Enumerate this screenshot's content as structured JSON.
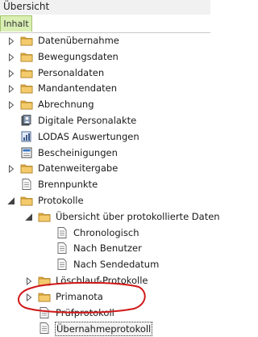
{
  "header": {
    "title": "Übersicht"
  },
  "tabs": [
    {
      "label": "Inhalt",
      "active": true
    }
  ],
  "tree": [
    {
      "label": "Datenübernahme",
      "icon": "folder-icon",
      "expander": "collapsed",
      "level": 0
    },
    {
      "label": "Bewegungsdaten",
      "icon": "folder-icon",
      "expander": "collapsed",
      "level": 0
    },
    {
      "label": "Personaldaten",
      "icon": "folder-icon",
      "expander": "collapsed",
      "level": 0
    },
    {
      "label": "Mandantendaten",
      "icon": "folder-icon",
      "expander": "collapsed",
      "level": 0
    },
    {
      "label": "Abrechnung",
      "icon": "folder-icon",
      "expander": "collapsed",
      "level": 0
    },
    {
      "label": "Digitale Personalakte",
      "icon": "personalakte-icon",
      "expander": "none",
      "level": 0
    },
    {
      "label": "LODAS Auswertungen",
      "icon": "report-icon",
      "expander": "none",
      "level": 0
    },
    {
      "label": "Bescheinigungen",
      "icon": "certificate-icon",
      "expander": "none",
      "level": 0
    },
    {
      "label": "Datenweitergabe",
      "icon": "folder-icon",
      "expander": "collapsed",
      "level": 0
    },
    {
      "label": "Brennpunkte",
      "icon": "document-icon",
      "expander": "none",
      "level": 0
    },
    {
      "label": "Protokolle",
      "icon": "folder-icon",
      "expander": "expanded",
      "level": 0
    },
    {
      "label": "Übersicht über protokollierte Daten",
      "icon": "folder-icon",
      "expander": "expanded",
      "level": 1
    },
    {
      "label": "Chronologisch",
      "icon": "document-icon",
      "expander": "none",
      "level": 2
    },
    {
      "label": "Nach Benutzer",
      "icon": "document-icon",
      "expander": "none",
      "level": 2
    },
    {
      "label": "Nach Sendedatum",
      "icon": "document-icon",
      "expander": "none",
      "level": 2
    },
    {
      "label": "Löschlauf-Protokolle",
      "icon": "folder-icon",
      "expander": "collapsed",
      "level": 1
    },
    {
      "label": "Primanota",
      "icon": "folder-icon",
      "expander": "collapsed",
      "level": 1
    },
    {
      "label": "Prüfprotokoll",
      "icon": "document-icon",
      "expander": "none",
      "level": 1
    },
    {
      "label": "Übernahmeprotokoll",
      "icon": "document-icon",
      "expander": "none",
      "level": 1,
      "selected": true
    }
  ],
  "colors": {
    "tab_active_bg": "#d9efb3",
    "folder": "#e8b64a",
    "annotation": "#d01818"
  }
}
